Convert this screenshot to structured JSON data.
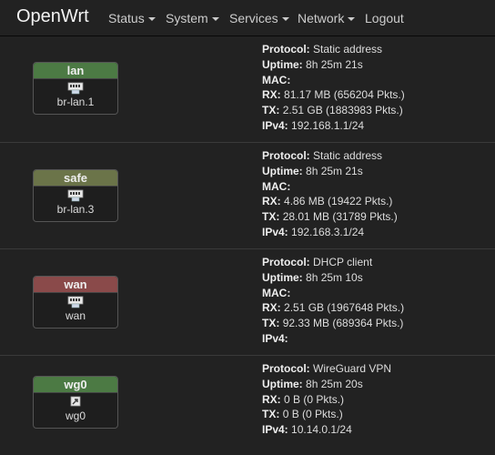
{
  "nav": {
    "brand": "OpenWrt",
    "menu": [
      {
        "label": "Status",
        "has_caret": true
      },
      {
        "label": "System",
        "has_caret": true
      },
      {
        "label": "Services",
        "has_caret": true
      },
      {
        "label": "Network",
        "has_caret": true
      },
      {
        "label": "Logout",
        "has_caret": false
      }
    ]
  },
  "interfaces": [
    {
      "name": "lan",
      "device": "br-lan.1",
      "header_color": "#4c7a44",
      "icon": "ethernet-port-icon",
      "fields": [
        {
          "label": "Protocol:",
          "value": "Static address"
        },
        {
          "label": "Uptime:",
          "value": "8h 25m 21s"
        },
        {
          "label": "MAC:",
          "value": ""
        },
        {
          "label": "RX:",
          "value": "81.17 MB (656204 Pkts.)"
        },
        {
          "label": "TX:",
          "value": "2.51 GB (1883983 Pkts.)"
        },
        {
          "label": "IPv4:",
          "value": "192.168.1.1/24"
        }
      ]
    },
    {
      "name": "safe",
      "device": "br-lan.3",
      "header_color": "#6b7449",
      "icon": "ethernet-port-icon",
      "fields": [
        {
          "label": "Protocol:",
          "value": "Static address"
        },
        {
          "label": "Uptime:",
          "value": "8h 25m 21s"
        },
        {
          "label": "MAC:",
          "value": ""
        },
        {
          "label": "RX:",
          "value": "4.86 MB (19422 Pkts.)"
        },
        {
          "label": "TX:",
          "value": "28.01 MB (31789 Pkts.)"
        },
        {
          "label": "IPv4:",
          "value": "192.168.3.1/24"
        }
      ]
    },
    {
      "name": "wan",
      "device": "wan",
      "header_color": "#8a4a4a",
      "icon": "ethernet-port-icon",
      "fields": [
        {
          "label": "Protocol:",
          "value": "DHCP client"
        },
        {
          "label": "Uptime:",
          "value": "8h 25m 10s"
        },
        {
          "label": "MAC:",
          "value": ""
        },
        {
          "label": "RX:",
          "value": "2.51 GB (1967648 Pkts.)"
        },
        {
          "label": "TX:",
          "value": "92.33 MB (689364 Pkts.)"
        },
        {
          "label": "IPv4:",
          "value": ""
        }
      ]
    },
    {
      "name": "wg0",
      "device": "wg0",
      "header_color": "#4c7a44",
      "icon": "tunnel-icon",
      "fields": [
        {
          "label": "Protocol:",
          "value": "WireGuard VPN"
        },
        {
          "label": "Uptime:",
          "value": "8h 25m 20s"
        },
        {
          "label": "RX:",
          "value": "0 B (0 Pkts.)"
        },
        {
          "label": "TX:",
          "value": "0 B (0 Pkts.)"
        },
        {
          "label": "IPv4:",
          "value": "10.14.0.1/24"
        }
      ]
    }
  ]
}
